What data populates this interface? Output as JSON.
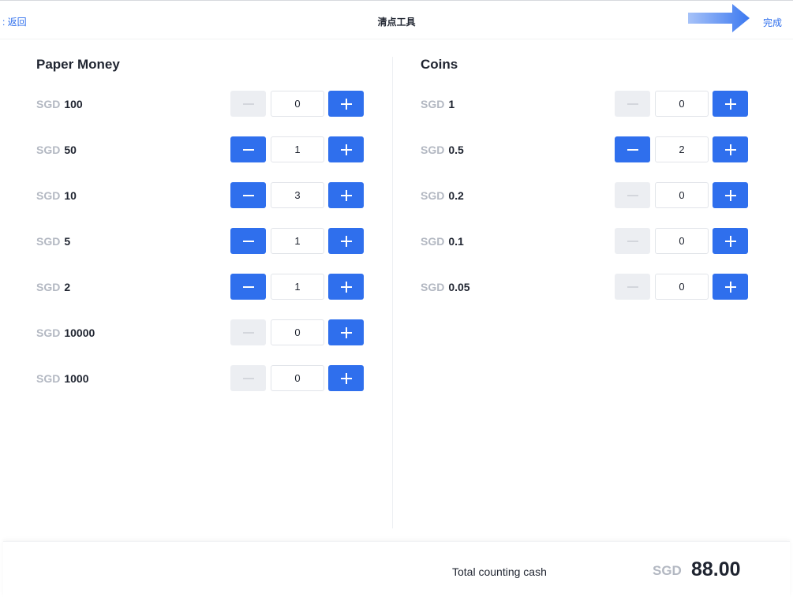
{
  "header": {
    "back_label": ": 返回",
    "title": "清点工具",
    "done_label": "完成"
  },
  "paper": {
    "title": "Paper Money",
    "rows": [
      {
        "currency": "SGD",
        "denomination": "100",
        "quantity": "0"
      },
      {
        "currency": "SGD",
        "denomination": "50",
        "quantity": "1"
      },
      {
        "currency": "SGD",
        "denomination": "10",
        "quantity": "3"
      },
      {
        "currency": "SGD",
        "denomination": "5",
        "quantity": "1"
      },
      {
        "currency": "SGD",
        "denomination": "2",
        "quantity": "1"
      },
      {
        "currency": "SGD",
        "denomination": "10000",
        "quantity": "0"
      },
      {
        "currency": "SGD",
        "denomination": "1000",
        "quantity": "0"
      }
    ]
  },
  "coins": {
    "title": "Coins",
    "rows": [
      {
        "currency": "SGD",
        "denomination": "1",
        "quantity": "0"
      },
      {
        "currency": "SGD",
        "denomination": "0.5",
        "quantity": "2"
      },
      {
        "currency": "SGD",
        "denomination": "0.2",
        "quantity": "0"
      },
      {
        "currency": "SGD",
        "denomination": "0.1",
        "quantity": "0"
      },
      {
        "currency": "SGD",
        "denomination": "0.05",
        "quantity": "0"
      }
    ]
  },
  "footer": {
    "total_label": "Total counting cash",
    "currency": "SGD",
    "total_value": "88.00"
  },
  "colors": {
    "accent": "#2f6fed",
    "disabled_button": "#eceef2",
    "currency_text": "#b3b8c2",
    "annotation_arrow": "#3b78f0"
  },
  "icons": {
    "minus": "minus-icon",
    "plus": "plus-icon",
    "annotation": "arrow-right-icon"
  }
}
